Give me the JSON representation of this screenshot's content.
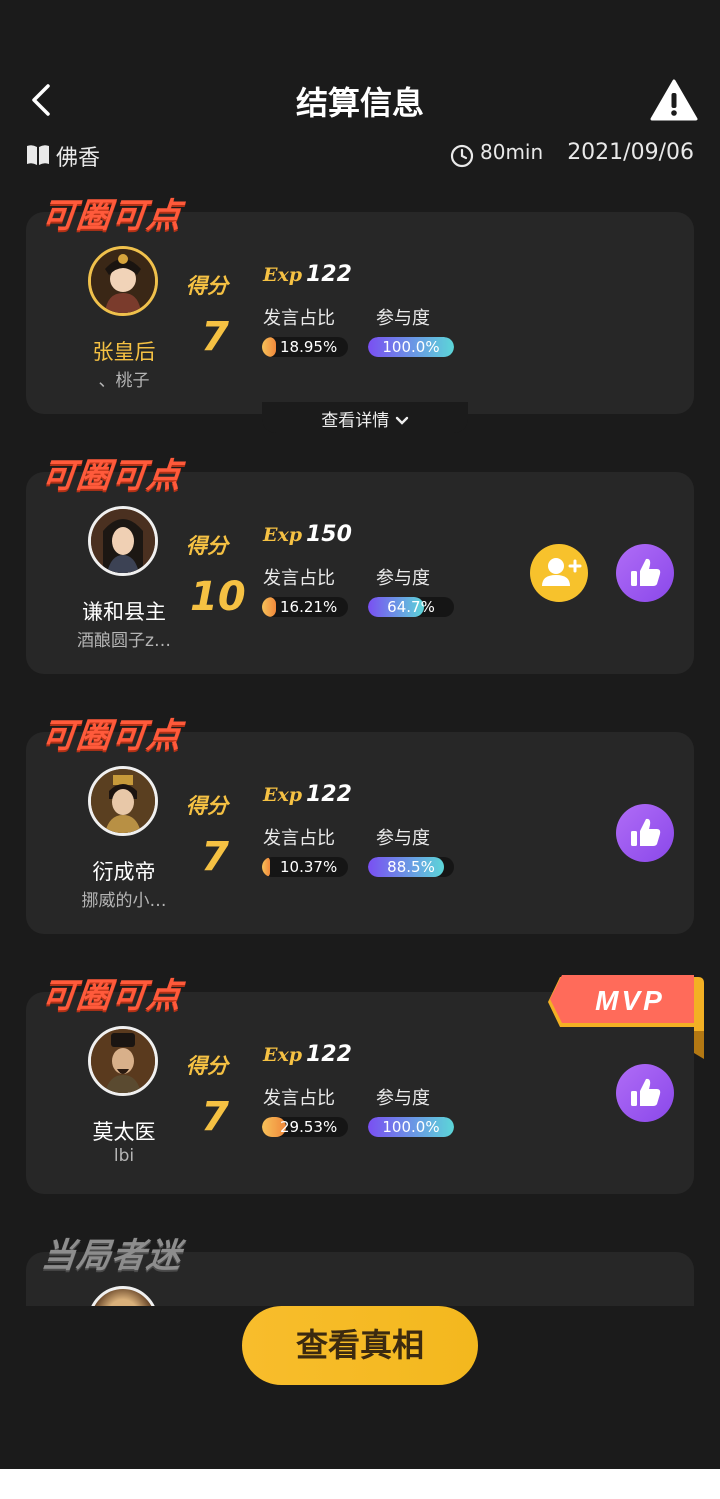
{
  "header": {
    "title": "结算信息"
  },
  "meta": {
    "room": "佛香",
    "duration": "80min",
    "date": "2021/09/06"
  },
  "labels": {
    "score": "得分",
    "exp": "Exp",
    "speech": "发言占比",
    "participation": "参与度",
    "detail": "查看详情",
    "mvp": "MVP"
  },
  "players": [
    {
      "tag": "可圈可点",
      "role": "张皇后",
      "user": "、桃子",
      "score": "7",
      "exp": "122",
      "speech": "18.95%",
      "speech_fraction": 0.1895,
      "participation": "100.0%",
      "participation_fraction": 1.0
    },
    {
      "tag": "可圈可点",
      "role": "谦和县主",
      "user": "酒酿圆子z…",
      "score": "10",
      "exp": "150",
      "speech": "16.21%",
      "speech_fraction": 0.1621,
      "participation": "64.7%",
      "participation_fraction": 0.647
    },
    {
      "tag": "可圈可点",
      "role": "衍成帝",
      "user": "挪威的小…",
      "score": "7",
      "exp": "122",
      "speech": "10.37%",
      "speech_fraction": 0.1037,
      "participation": "88.5%",
      "participation_fraction": 0.885
    },
    {
      "tag": "可圈可点",
      "role": "莫太医",
      "user": "lbi",
      "score": "7",
      "exp": "122",
      "speech": "29.53%",
      "speech_fraction": 0.2953,
      "participation": "100.0%",
      "participation_fraction": 1.0
    }
  ],
  "last_tag": "当局者迷",
  "footer": {
    "reveal_label": "查看真相"
  },
  "icons": [
    "back-arrow-icon",
    "warning-icon",
    "book-icon",
    "clock-icon",
    "chevron-down-icon",
    "add-friend-icon",
    "thumbs-up-icon"
  ],
  "colors": {
    "accent": "#f5c143",
    "tag": "#ff5a3b",
    "like": "#9b58f0",
    "add": "#f7c22c"
  }
}
